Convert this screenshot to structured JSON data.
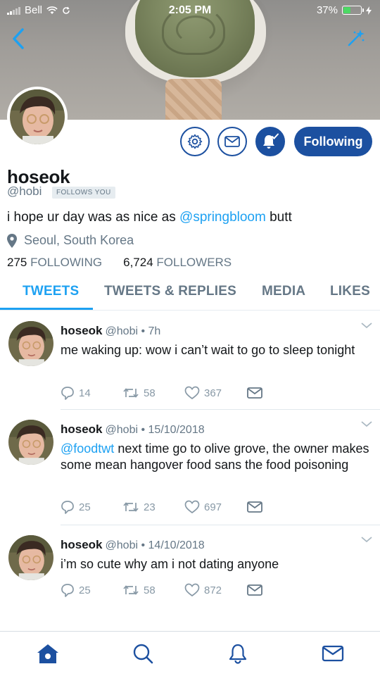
{
  "status_bar": {
    "carrier": "Bell",
    "time": "2:05 PM",
    "battery": "37%",
    "battery_level": 0.37
  },
  "profile": {
    "name": "hoseok",
    "handle": "@hobi",
    "follows_you": "FOLLOWS YOU",
    "bio_prefix": "i hope ur day was as nice as ",
    "bio_mention": "@springbloom",
    "bio_suffix": " butt",
    "location": "Seoul, South Korea",
    "following_count": "275",
    "following_label": "FOLLOWING",
    "followers_count": "6,724",
    "followers_label": "FOLLOWERS",
    "follow_button": "Following"
  },
  "tabs": [
    {
      "label": "TWEETS",
      "active": true
    },
    {
      "label": "TWEETS & REPLIES",
      "active": false
    },
    {
      "label": "MEDIA",
      "active": false
    },
    {
      "label": "LIKES",
      "active": false
    }
  ],
  "tweets": [
    {
      "name": "hoseok",
      "handle": "@hobi",
      "time": "7h",
      "mention": "",
      "text": "me waking up: wow i can’t wait to go to sleep tonight",
      "replies": "14",
      "retweets": "58",
      "likes": "367"
    },
    {
      "name": "hoseok",
      "handle": "@hobi",
      "time": "15/10/2018",
      "mention": "@foodtwt",
      "text": " next time go to olive grove, the owner makes some mean hangover food sans the food poisoning",
      "replies": "25",
      "retweets": "23",
      "likes": "697"
    },
    {
      "name": "hoseok",
      "handle": "@hobi",
      "time": "14/10/2018",
      "mention": "",
      "text": "i’m so cute why am i not dating anyone",
      "replies": "25",
      "retweets": "58",
      "likes": "872"
    }
  ],
  "colors": {
    "brand_blue": "#1c50a0",
    "link_blue": "#1da1f2",
    "muted": "#657786",
    "battery_green": "#4cd964"
  },
  "icons": [
    "back-arrow-icon",
    "sparkle-icon",
    "gear-icon",
    "mail-icon",
    "bell-check-icon",
    "location-pin-icon",
    "chevron-down-icon",
    "reply-icon",
    "retweet-icon",
    "heart-icon",
    "home-icon",
    "search-icon",
    "notifications-icon"
  ]
}
